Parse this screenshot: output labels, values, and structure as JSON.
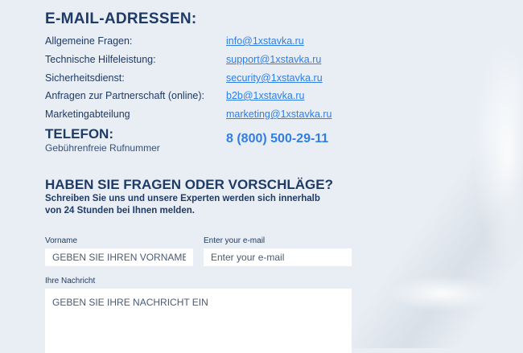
{
  "email_section": {
    "heading": "E-MAIL-ADRESSEN:",
    "rows": [
      {
        "label": "Allgemeine Fragen:",
        "email": "info@1xstavka.ru"
      },
      {
        "label": "Technische Hilfeleistung:",
        "email": "support@1xstavka.ru"
      },
      {
        "label": "Sicherheitsdienst:",
        "email": "security@1xstavka.ru"
      },
      {
        "label": "Anfragen zur Partnerschaft (online):",
        "email": "b2b@1xstavka.ru"
      },
      {
        "label": "Marketingabteilung",
        "email": "marketing@1xstavka.ru"
      }
    ]
  },
  "phone_section": {
    "heading": "TELEFON:",
    "subtitle": "Gebührenfreie Rufnummer",
    "number": "8 (800) 500-29-11"
  },
  "form": {
    "heading": "HABEN SIE FRAGEN ODER VORSCHLÄGE?",
    "subtitle": "Schreiben Sie uns und unsere Experten werden sich innerhalb von 24 Stunden bei Ihnen melden.",
    "first_name": {
      "label": "Vorname",
      "placeholder": "GEBEN SIE IHREN VORNAMEN AN"
    },
    "email": {
      "label": "Enter your e-mail",
      "placeholder": "Enter your e-mail"
    },
    "message": {
      "label": "Ihre Nachricht",
      "placeholder": "GEBEN SIE IHRE NACHRICHT EIN"
    }
  },
  "colors": {
    "heading": "#1e3a66",
    "link": "#2f7de6",
    "background": "#e9eef4"
  }
}
